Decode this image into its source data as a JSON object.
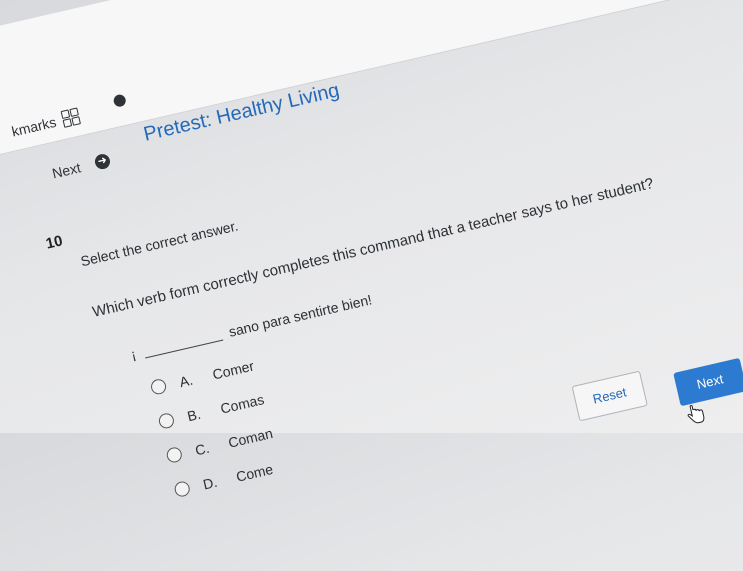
{
  "browser": {
    "bookmarks_label": "kmarks"
  },
  "header": {
    "next_label": "Next",
    "title": "Pretest: Healthy Living"
  },
  "question": {
    "number": "10",
    "instruction": "Select the correct answer.",
    "prompt": "Which verb form correctly completes this command that a teacher says to her student?",
    "sentence_prefix": "¡",
    "sentence_suffix": "sano para sentirte bien!"
  },
  "options": [
    {
      "letter": "A.",
      "text": "Comer"
    },
    {
      "letter": "B.",
      "text": "Comas"
    },
    {
      "letter": "C.",
      "text": "Coman"
    },
    {
      "letter": "D.",
      "text": "Come"
    }
  ],
  "actions": {
    "reset_label": "Reset",
    "next_label": "Next"
  },
  "icons": {
    "grid": "grid-icon",
    "next_arrow": "arrow-right-circle-icon",
    "cursor": "hand-cursor-icon"
  },
  "colors": {
    "title_blue": "#2569b9",
    "next_button_blue": "#2d7bd1"
  }
}
